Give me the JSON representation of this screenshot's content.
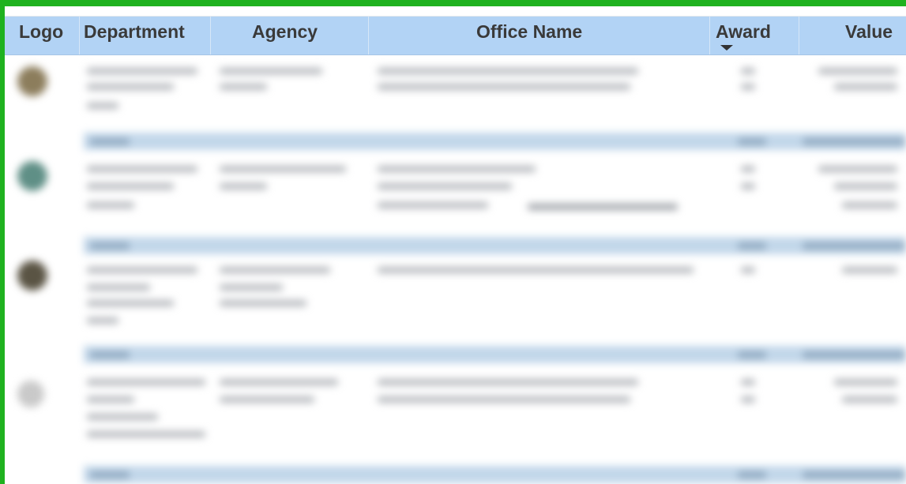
{
  "table": {
    "columns": [
      {
        "key": "logo",
        "label": "Logo"
      },
      {
        "key": "department",
        "label": "Department"
      },
      {
        "key": "agency",
        "label": "Agency"
      },
      {
        "key": "office_name",
        "label": "Office Name"
      },
      {
        "key": "award",
        "label": "Award",
        "sorted": "descending"
      },
      {
        "key": "value",
        "label": "Value"
      }
    ],
    "rows": [
      {
        "logo_color": "#8c7d5c"
      },
      {
        "logo_color": "#5f8f86"
      },
      {
        "logo_color": "#5a5444"
      },
      {
        "logo_color": "#c9c9c9"
      }
    ]
  },
  "colors": {
    "frame": "#1fb21f",
    "header_bg": "#b2d3f5",
    "subbar_bg": "#c2d7ea"
  }
}
